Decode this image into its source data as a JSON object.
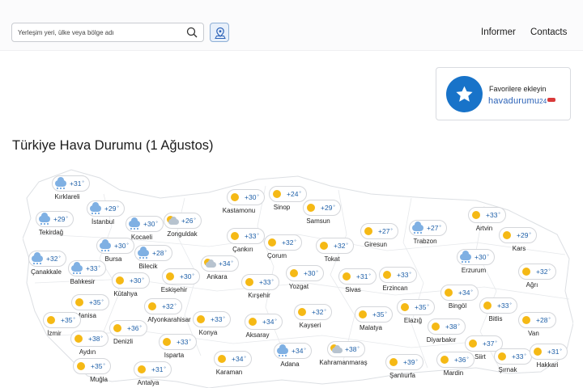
{
  "header": {
    "search_placeholder": "Yerleşim yeri, ülke veya bölge adı",
    "nav": [
      "Informer",
      "Contacts"
    ]
  },
  "favorite_card": {
    "text": "Favorilere ekleyin",
    "brand": "havadurumu",
    "brand_num": "24"
  },
  "page_title": "Türkiye Hava Durumu (1 Ağustos)",
  "colors": {
    "accent": "#1873c9",
    "temp_text": "#1d5fa8",
    "sun": "#f5b915"
  },
  "cities": [
    {
      "name": "Kırklareli",
      "temp": "+31",
      "icon": "cloud-rain-icon"
    },
    {
      "name": "İstanbul",
      "temp": "+29",
      "icon": "cloud-rain-icon"
    },
    {
      "name": "Tekirdağ",
      "temp": "+29",
      "icon": "cloud-rain-icon"
    },
    {
      "name": "Kocaeli",
      "temp": "+30",
      "icon": "cloud-rain-icon"
    },
    {
      "name": "Zonguldak",
      "temp": "+26",
      "icon": "partly-cloudy-icon"
    },
    {
      "name": "Kastamonu",
      "temp": "+30",
      "icon": "sun-icon"
    },
    {
      "name": "Sinop",
      "temp": "+24",
      "icon": "sun-icon"
    },
    {
      "name": "Samsun",
      "temp": "+29",
      "icon": "sun-icon"
    },
    {
      "name": "Giresun",
      "temp": "+27",
      "icon": "sun-icon"
    },
    {
      "name": "Trabzon",
      "temp": "+27",
      "icon": "cloud-rain-icon"
    },
    {
      "name": "Artvin",
      "temp": "+33",
      "icon": "sun-icon"
    },
    {
      "name": "Kars",
      "temp": "+29",
      "icon": "sun-icon"
    },
    {
      "name": "Çanakkale",
      "temp": "+32",
      "icon": "cloud-rain-icon"
    },
    {
      "name": "Balıkesir",
      "temp": "+33",
      "icon": "cloud-rain-icon"
    },
    {
      "name": "Bursa",
      "temp": "+30",
      "icon": "cloud-rain-icon"
    },
    {
      "name": "Bilecik",
      "temp": "+28",
      "icon": "cloud-rain-icon"
    },
    {
      "name": "Çankırı",
      "temp": "+33",
      "icon": "sun-icon"
    },
    {
      "name": "Çorum",
      "temp": "+32",
      "icon": "sun-icon"
    },
    {
      "name": "Tokat",
      "temp": "+32",
      "icon": "sun-icon"
    },
    {
      "name": "Erzurum",
      "temp": "+30",
      "icon": "cloud-rain-icon"
    },
    {
      "name": "Ağrı",
      "temp": "+32",
      "icon": "sun-icon"
    },
    {
      "name": "Kütahya",
      "temp": "+30",
      "icon": "sun-icon"
    },
    {
      "name": "Eskişehir",
      "temp": "+30",
      "icon": "sun-icon"
    },
    {
      "name": "Ankara",
      "temp": "+34",
      "icon": "partly-cloudy-icon"
    },
    {
      "name": "Kırşehir",
      "temp": "+33",
      "icon": "sun-icon"
    },
    {
      "name": "Yozgat",
      "temp": "+30",
      "icon": "sun-icon"
    },
    {
      "name": "Sivas",
      "temp": "+31",
      "icon": "sun-icon"
    },
    {
      "name": "Erzincan",
      "temp": "+33",
      "icon": "sun-icon"
    },
    {
      "name": "Bingöl",
      "temp": "+34",
      "icon": "sun-icon"
    },
    {
      "name": "Bitlis",
      "temp": "+33",
      "icon": "sun-icon"
    },
    {
      "name": "Van",
      "temp": "+28",
      "icon": "sun-icon"
    },
    {
      "name": "Manisa",
      "temp": "+35",
      "icon": "sun-icon"
    },
    {
      "name": "İzmir",
      "temp": "+35",
      "icon": "sun-icon"
    },
    {
      "name": "Afyonkarahisar",
      "temp": "+32",
      "icon": "sun-icon"
    },
    {
      "name": "Konya",
      "temp": "+33",
      "icon": "sun-icon"
    },
    {
      "name": "Aksaray",
      "temp": "+34",
      "icon": "sun-icon"
    },
    {
      "name": "Kayseri",
      "temp": "+32",
      "icon": "sun-icon"
    },
    {
      "name": "Malatya",
      "temp": "+35",
      "icon": "sun-icon"
    },
    {
      "name": "Elazığ",
      "temp": "+35",
      "icon": "sun-icon"
    },
    {
      "name": "Diyarbakır",
      "temp": "+38",
      "icon": "sun-icon"
    },
    {
      "name": "Aydın",
      "temp": "+38",
      "icon": "sun-icon"
    },
    {
      "name": "Denizli",
      "temp": "+36",
      "icon": "sun-icon"
    },
    {
      "name": "Isparta",
      "temp": "+33",
      "icon": "sun-icon"
    },
    {
      "name": "Karaman",
      "temp": "+34",
      "icon": "sun-icon"
    },
    {
      "name": "Adana",
      "temp": "+34",
      "icon": "cloud-rain-icon"
    },
    {
      "name": "Kahramanmaraş",
      "temp": "+38",
      "icon": "partly-cloudy-icon"
    },
    {
      "name": "Şanlıurfa",
      "temp": "+39",
      "icon": "sun-icon"
    },
    {
      "name": "Mardin",
      "temp": "+36",
      "icon": "sun-icon"
    },
    {
      "name": "Siirt",
      "temp": "+37",
      "icon": "sun-icon"
    },
    {
      "name": "Şırnak",
      "temp": "+33",
      "icon": "sun-icon"
    },
    {
      "name": "Hakkari",
      "temp": "+31",
      "icon": "sun-icon"
    },
    {
      "name": "Muğla",
      "temp": "+35",
      "icon": "sun-icon"
    },
    {
      "name": "Antalya",
      "temp": "+31",
      "icon": "sun-icon"
    }
  ]
}
